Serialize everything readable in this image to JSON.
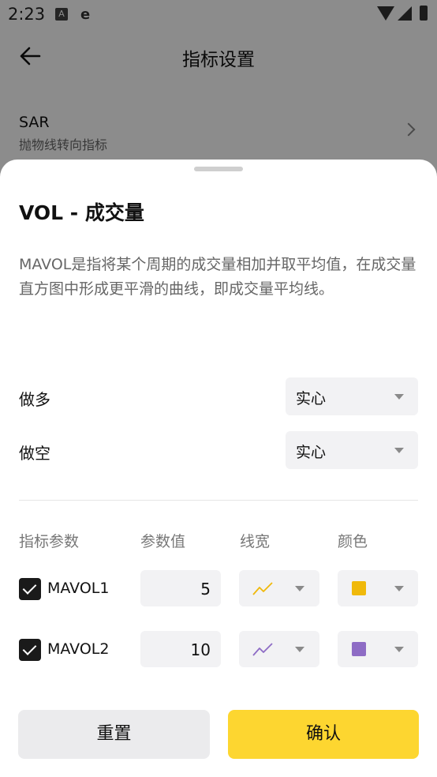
{
  "status_bar": {
    "time": "2:23",
    "icon_a": "A",
    "icon_e": "e"
  },
  "header": {
    "title": "指标设置"
  },
  "background_item": {
    "title": "SAR",
    "subtitle": "抛物线转向指标"
  },
  "sheet": {
    "title": "VOL - 成交量",
    "description": "MAVOL是指将某个周期的成交量相加并取平均值，在成交量直方图中形成更平滑的曲线，即成交量平均线。",
    "long": {
      "label": "做多",
      "value": "实心"
    },
    "short": {
      "label": "做空",
      "value": "实心"
    },
    "columns": {
      "param": "指标参数",
      "value": "参数值",
      "width": "线宽",
      "color": "颜色"
    },
    "params": [
      {
        "name": "MAVOL1",
        "checked": true,
        "value": "5",
        "line_color": "#f0b90b",
        "color": "#f0b90b"
      },
      {
        "name": "MAVOL2",
        "checked": true,
        "value": "10",
        "line_color": "#8e6cc5",
        "color": "#8e6cc5"
      }
    ],
    "buttons": {
      "reset": "重置",
      "confirm": "确认"
    }
  },
  "colors": {
    "accent": "#fdd630",
    "input_bg": "#f2f2f4"
  }
}
